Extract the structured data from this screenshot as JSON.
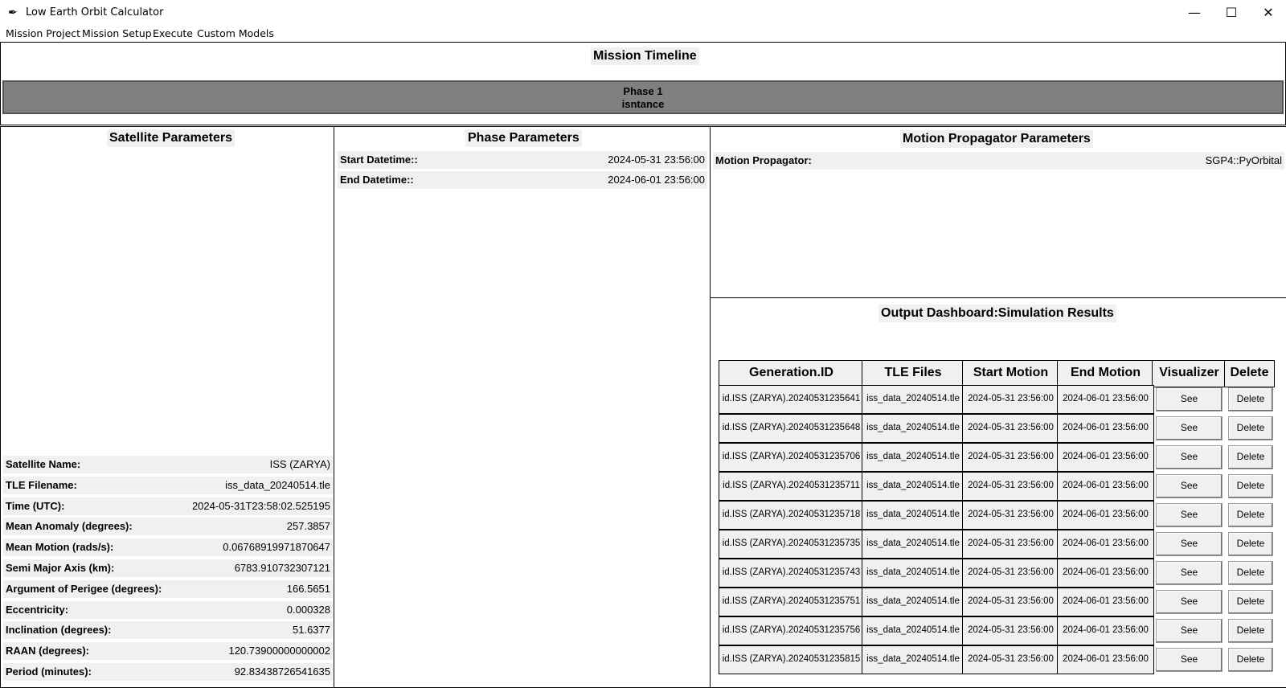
{
  "window": {
    "title": "Low Earth Orbit Calculator",
    "min_glyph": "—",
    "max_glyph": "☐",
    "close_glyph": "✕",
    "icon": "feather-icon"
  },
  "menu": [
    "Mission Project",
    "Mission Setup",
    "Execute",
    "Custom Models"
  ],
  "timeline": {
    "title": "Mission Timeline",
    "phase_label": "Phase 1",
    "phase_name": "isntance"
  },
  "satellite": {
    "title": "Satellite Parameters",
    "rows": [
      {
        "label": "Satellite Name:",
        "value": "ISS (ZARYA)"
      },
      {
        "label": "TLE Filename:",
        "value": "iss_data_20240514.tle"
      },
      {
        "label": "Time (UTC):",
        "value": "2024-05-31T23:58:02.525195"
      },
      {
        "label": "Mean Anomaly (degrees):",
        "value": "257.3857"
      },
      {
        "label": "Mean Motion (rads/s):",
        "value": "0.06768919971870647"
      },
      {
        "label": "Semi Major Axis (km):",
        "value": "6783.910732307121"
      },
      {
        "label": "Argument of Perigee (degrees):",
        "value": "166.5651"
      },
      {
        "label": "Eccentricity:",
        "value": "0.000328"
      },
      {
        "label": "Inclination (degrees):",
        "value": "51.6377"
      },
      {
        "label": "RAAN (degrees):",
        "value": "120.73900000000002"
      },
      {
        "label": "Period (minutes):",
        "value": "92.83438726541635"
      }
    ]
  },
  "phase": {
    "title": "Phase Parameters",
    "rows": [
      {
        "label": "Start Datetime::",
        "value": "2024-05-31 23:56:00"
      },
      {
        "label": "End Datetime::",
        "value": "2024-06-01 23:56:00"
      }
    ]
  },
  "motion": {
    "title": "Motion Propagator Parameters",
    "label": "Motion Propagator:",
    "value": "SGP4::PyOrbital"
  },
  "output": {
    "title": "Output Dashboard:Simulation Results",
    "headers": [
      "Generation.ID",
      "TLE Files",
      "Start Motion",
      "End Motion",
      "Visualizer",
      "Delete"
    ],
    "see_label": "See",
    "delete_label": "Delete",
    "rows": [
      {
        "id": "id.ISS (ZARYA).20240531235641",
        "tle": "iss_data_20240514.tle",
        "start": "2024-05-31 23:56:00",
        "end": "2024-06-01 23:56:00"
      },
      {
        "id": "id.ISS (ZARYA).20240531235648",
        "tle": "iss_data_20240514.tle",
        "start": "2024-05-31 23:56:00",
        "end": "2024-06-01 23:56:00"
      },
      {
        "id": "id.ISS (ZARYA).20240531235706",
        "tle": "iss_data_20240514.tle",
        "start": "2024-05-31 23:56:00",
        "end": "2024-06-01 23:56:00"
      },
      {
        "id": "id.ISS (ZARYA).20240531235711",
        "tle": "iss_data_20240514.tle",
        "start": "2024-05-31 23:56:00",
        "end": "2024-06-01 23:56:00"
      },
      {
        "id": "id.ISS (ZARYA).20240531235718",
        "tle": "iss_data_20240514.tle",
        "start": "2024-05-31 23:56:00",
        "end": "2024-06-01 23:56:00"
      },
      {
        "id": "id.ISS (ZARYA).20240531235735",
        "tle": "iss_data_20240514.tle",
        "start": "2024-05-31 23:56:00",
        "end": "2024-06-01 23:56:00"
      },
      {
        "id": "id.ISS (ZARYA).20240531235743",
        "tle": "iss_data_20240514.tle",
        "start": "2024-05-31 23:56:00",
        "end": "2024-06-01 23:56:00"
      },
      {
        "id": "id.ISS (ZARYA).20240531235751",
        "tle": "iss_data_20240514.tle",
        "start": "2024-05-31 23:56:00",
        "end": "2024-06-01 23:56:00"
      },
      {
        "id": "id.ISS (ZARYA).20240531235756",
        "tle": "iss_data_20240514.tle",
        "start": "2024-05-31 23:56:00",
        "end": "2024-06-01 23:56:00"
      },
      {
        "id": "id.ISS (ZARYA).20240531235815",
        "tle": "iss_data_20240514.tle",
        "start": "2024-05-31 23:56:00",
        "end": "2024-06-01 23:56:00"
      }
    ]
  }
}
